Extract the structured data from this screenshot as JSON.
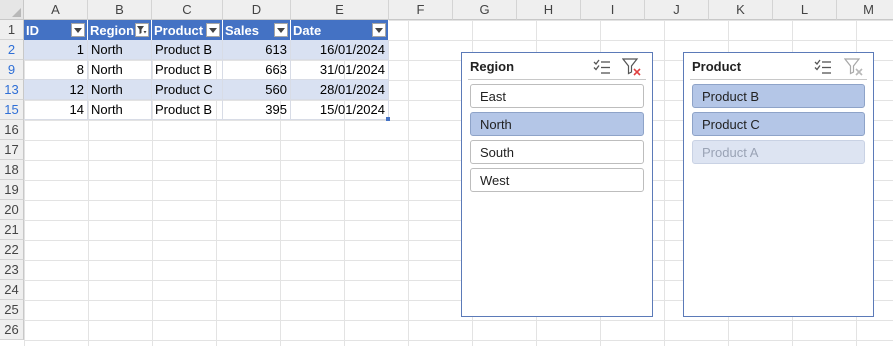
{
  "columns": [
    "A",
    "B",
    "C",
    "D",
    "E",
    "F",
    "G",
    "H",
    "I",
    "J",
    "K",
    "L",
    "M"
  ],
  "rows": [
    "1",
    "2",
    "9",
    "13",
    "15",
    "16",
    "17",
    "18",
    "19",
    "20",
    "21",
    "22",
    "23",
    "24",
    "25",
    "26"
  ],
  "table": {
    "headers": [
      "ID",
      "Region",
      "Product",
      "Sales",
      "Date"
    ],
    "region_filter_active": true,
    "rows": [
      {
        "id": "1",
        "region": "North",
        "product": "Product B",
        "sales": "613",
        "date": "16/01/2024"
      },
      {
        "id": "8",
        "region": "North",
        "product": "Product B",
        "sales": "663",
        "date": "31/01/2024"
      },
      {
        "id": "12",
        "region": "North",
        "product": "Product C",
        "sales": "560",
        "date": "28/01/2024"
      },
      {
        "id": "14",
        "region": "North",
        "product": "Product B",
        "sales": "395",
        "date": "15/01/2024"
      }
    ]
  },
  "slicers": {
    "region": {
      "title": "Region",
      "items": [
        {
          "label": "East",
          "state": "unselected"
        },
        {
          "label": "North",
          "state": "selected"
        },
        {
          "label": "South",
          "state": "unselected"
        },
        {
          "label": "West",
          "state": "unselected"
        }
      ]
    },
    "product": {
      "title": "Product",
      "items": [
        {
          "label": "Product B",
          "state": "selected"
        },
        {
          "label": "Product C",
          "state": "selected"
        },
        {
          "label": "Product A",
          "state": "no-data"
        }
      ]
    }
  },
  "colors": {
    "table_header": "#4472c4",
    "band": "#d9e1f2",
    "slicer_selected": "#b4c6e7",
    "filtered_row_number": "#2f6fd6"
  },
  "icons": [
    "multi-select-icon",
    "clear-filter-icon",
    "filter-dropdown-icon",
    "filter-applied-icon"
  ]
}
